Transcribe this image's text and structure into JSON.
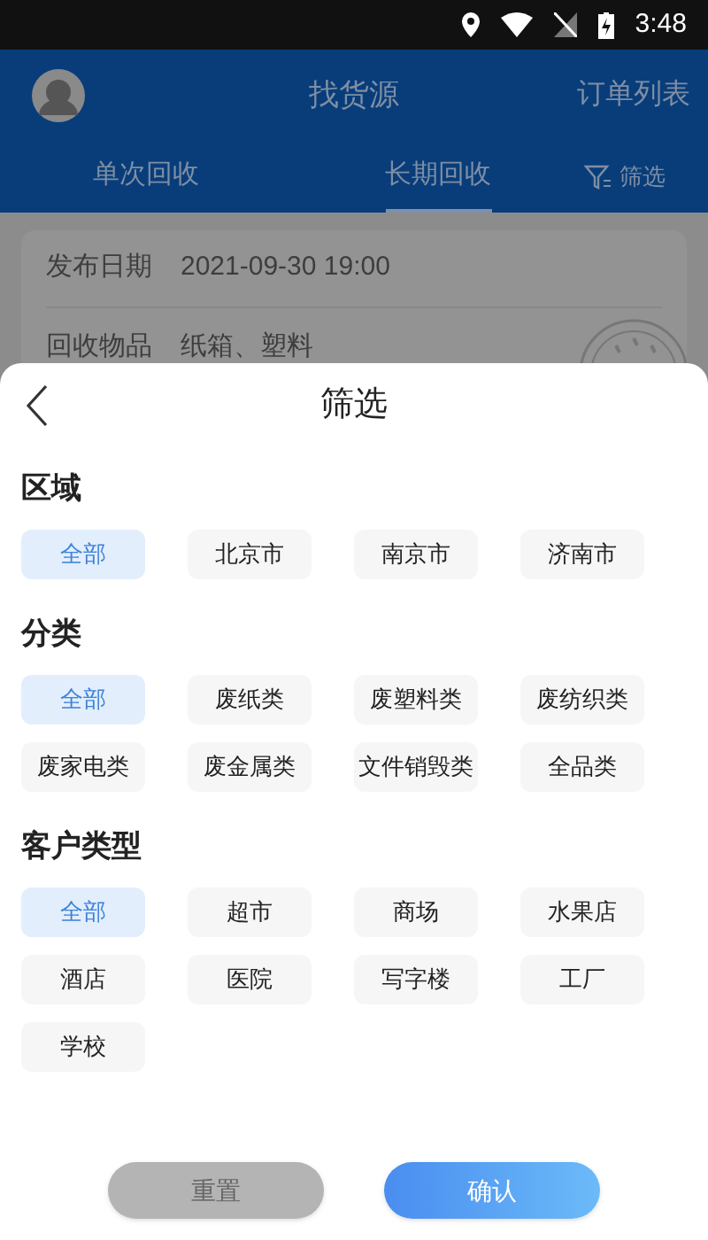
{
  "status_bar": {
    "time": "3:48"
  },
  "header": {
    "title": "找货源",
    "action": "订单列表"
  },
  "tabs": [
    {
      "label": "单次回收",
      "selected": false
    },
    {
      "label": "长期回收",
      "selected": true
    }
  ],
  "filter_button": {
    "label": "筛选"
  },
  "card": {
    "rows": [
      {
        "label": "发布日期",
        "value": "2021-09-30 19:00"
      },
      {
        "label": "回收物品",
        "value": "纸箱、塑料"
      }
    ]
  },
  "sheet": {
    "title": "筛选",
    "sections": [
      {
        "title": "区域",
        "options": [
          {
            "label": "全部",
            "selected": true
          },
          {
            "label": "北京市",
            "selected": false
          },
          {
            "label": "南京市",
            "selected": false
          },
          {
            "label": "济南市",
            "selected": false
          }
        ]
      },
      {
        "title": "分类",
        "options": [
          {
            "label": "全部",
            "selected": true
          },
          {
            "label": "废纸类",
            "selected": false
          },
          {
            "label": "废塑料类",
            "selected": false
          },
          {
            "label": "废纺织类",
            "selected": false
          },
          {
            "label": "废家电类",
            "selected": false
          },
          {
            "label": "废金属类",
            "selected": false
          },
          {
            "label": "文件销毁类",
            "selected": false
          },
          {
            "label": "全品类",
            "selected": false
          }
        ]
      },
      {
        "title": "客户类型",
        "options": [
          {
            "label": "全部",
            "selected": true
          },
          {
            "label": "超市",
            "selected": false
          },
          {
            "label": "商场",
            "selected": false
          },
          {
            "label": "水果店",
            "selected": false
          },
          {
            "label": "酒店",
            "selected": false
          },
          {
            "label": "医院",
            "selected": false
          },
          {
            "label": "写字楼",
            "selected": false
          },
          {
            "label": "工厂",
            "selected": false
          },
          {
            "label": "学校",
            "selected": false
          }
        ]
      }
    ],
    "reset": "重置",
    "confirm": "确认"
  }
}
